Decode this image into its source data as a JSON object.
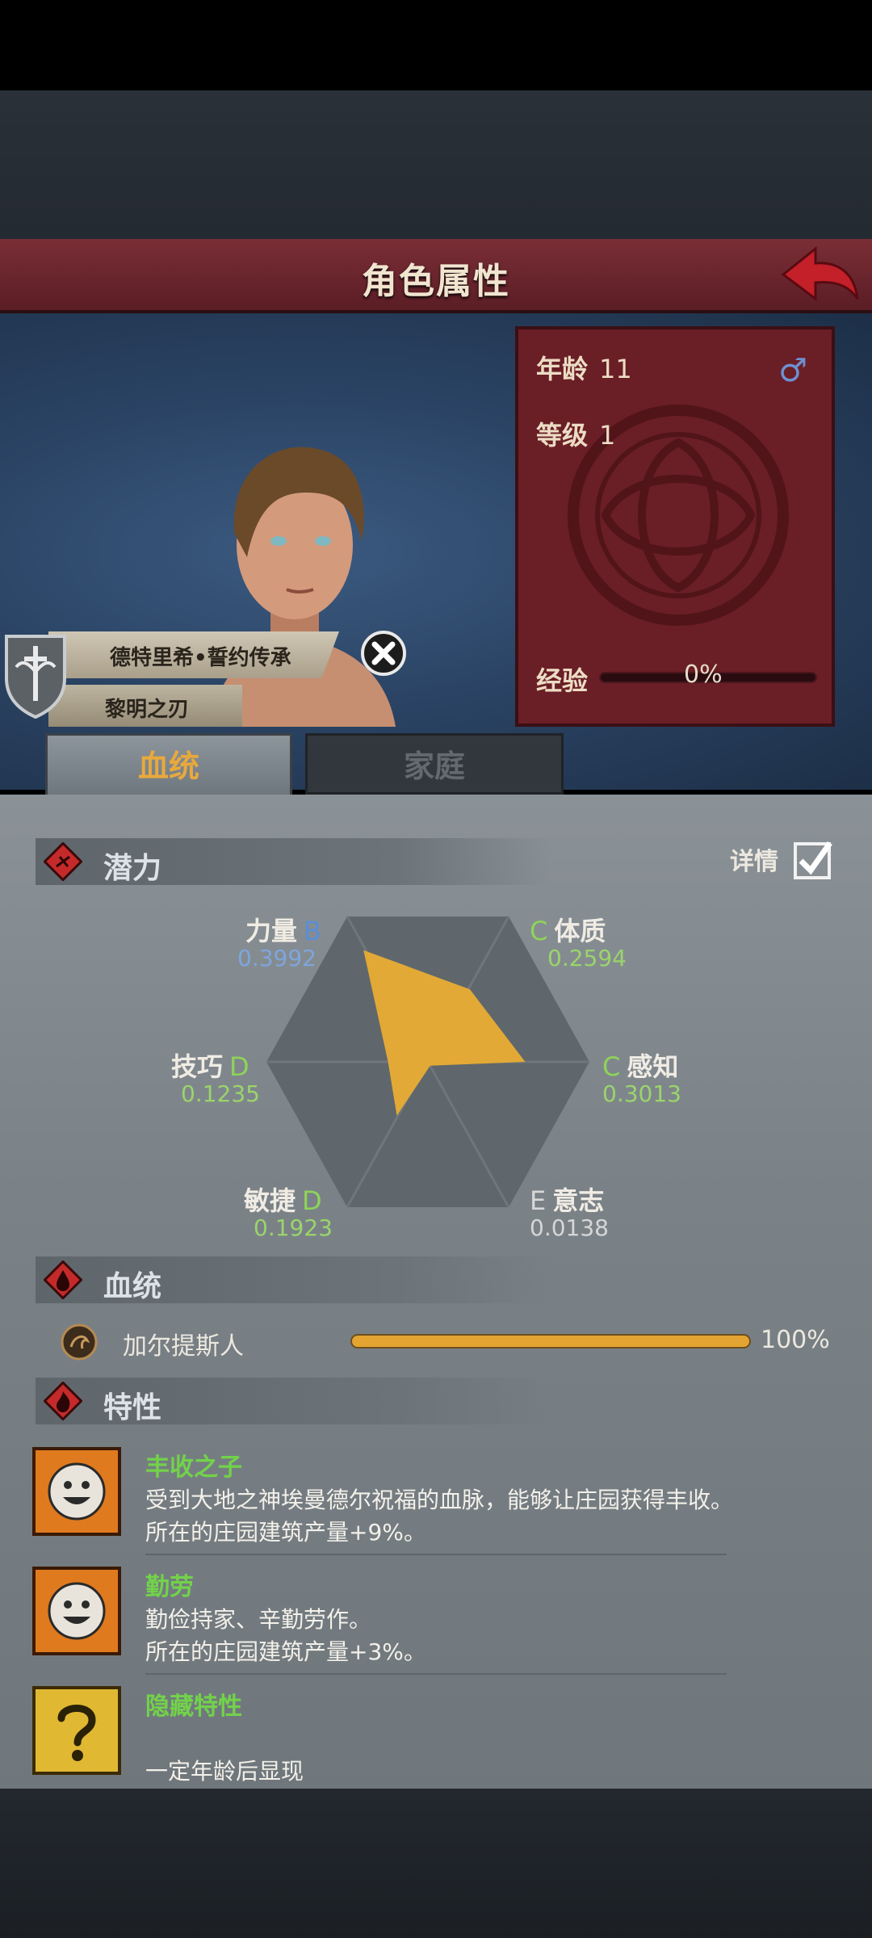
{
  "header": {
    "title": "角色属性"
  },
  "stats": {
    "age_label": "年龄",
    "age_value": "11",
    "gender_symbol": "♂",
    "level_label": "等级",
    "level_value": "1",
    "exp_label": "经验",
    "exp_value": "0%",
    "exp_progress": 0
  },
  "lineage": {
    "house": "德特里希•誓约传承",
    "title": "黎明之刃"
  },
  "tabs": [
    {
      "label": "血统",
      "active": true
    },
    {
      "label": "家庭",
      "active": false
    }
  ],
  "potential": {
    "section_label": "潜力",
    "detail_label": "详情",
    "detail_checked": true,
    "attributes": [
      {
        "name": "力量",
        "grade": "B",
        "value": "0.3992"
      },
      {
        "name": "体质",
        "grade": "C",
        "value": "0.2594"
      },
      {
        "name": "技巧",
        "grade": "D",
        "value": "0.1235"
      },
      {
        "name": "感知",
        "grade": "C",
        "value": "0.3013"
      },
      {
        "name": "敏捷",
        "grade": "D",
        "value": "0.1923"
      },
      {
        "name": "意志",
        "grade": "E",
        "value": "0.0138"
      }
    ]
  },
  "bloodline": {
    "section_label": "血统",
    "name": "加尔提斯人",
    "percent": "100%",
    "fraction": 1.0
  },
  "traits": {
    "section_label": "特性",
    "items": [
      {
        "name": "丰收之子",
        "desc1": "受到大地之神埃曼德尔祝福的血脉，能够让庄园获得丰收。",
        "desc2": "所在的庄园建筑产量+9%。",
        "icon": "smiley-icon"
      },
      {
        "name": "勤劳",
        "desc1": "勤俭持家、辛勤劳作。",
        "desc2": "所在的庄园建筑产量+3%。",
        "icon": "smiley-icon"
      },
      {
        "name": "隐藏特性",
        "desc1": "",
        "desc2": "一定年龄后显现",
        "icon": "question-icon"
      }
    ]
  },
  "colors": {
    "accent_red": "#6a1e26",
    "trait_green": "#72d24a",
    "radar_fill": "#e2a936"
  }
}
